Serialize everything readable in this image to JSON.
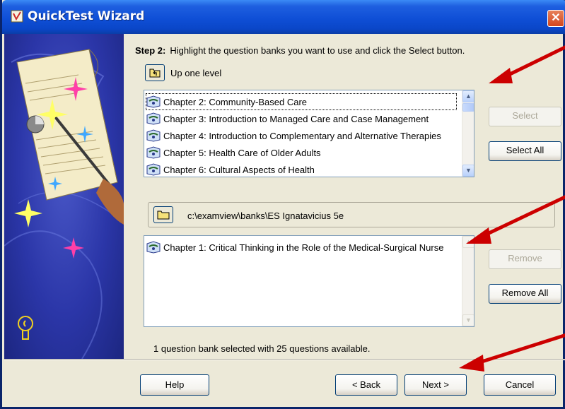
{
  "window": {
    "title": "QuickTest Wizard"
  },
  "step": {
    "label": "Step 2:",
    "instruction": "Highlight the question banks you want to use and click the Select button."
  },
  "nav": {
    "up_label": "Up one level"
  },
  "available_banks": [
    "Chapter 2: Community-Based Care",
    "Chapter 3: Introduction to Managed Care and Case Management",
    "Chapter 4: Introduction to Complementary and Alternative Therapies",
    "Chapter 5: Health Care of Older Adults",
    "Chapter 6: Cultural Aspects of Health"
  ],
  "folder": {
    "path": "c:\\examview\\banks\\ES Ignatavicius 5e"
  },
  "selected_banks": [
    "Chapter 1: Critical Thinking in the Role of the Medical-Surgical Nurse"
  ],
  "buttons": {
    "select": "Select",
    "select_all": "Select All",
    "remove": "Remove",
    "remove_all": "Remove All",
    "help": "Help",
    "back": "< Back",
    "next": "Next >",
    "cancel": "Cancel"
  },
  "status": "1 question bank selected with 25 questions available.",
  "colors": {
    "titlebar": "#0a46c8",
    "arrow": "#cc0000",
    "sidebar": "#2b36a8"
  }
}
